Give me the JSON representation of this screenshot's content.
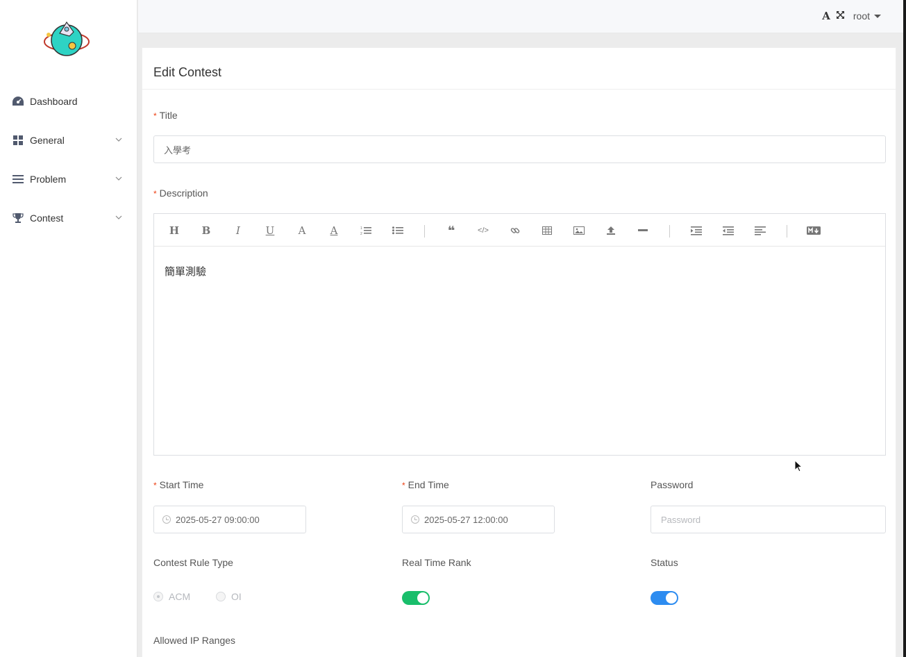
{
  "header": {
    "user": "root"
  },
  "sidebar": {
    "items": [
      {
        "label": "Dashboard"
      },
      {
        "label": "General"
      },
      {
        "label": "Problem"
      },
      {
        "label": "Contest"
      }
    ]
  },
  "card": {
    "title": "Edit Contest"
  },
  "form": {
    "title_label": "Title",
    "title_value": "入學考",
    "description_label": "Description",
    "description_value": "簡單測驗",
    "start_time_label": "Start Time",
    "start_time_value": "2025-05-27 09:00:00",
    "end_time_label": "End Time",
    "end_time_value": "2025-05-27 12:00:00",
    "password_label": "Password",
    "password_placeholder": "Password",
    "rule_type_label": "Contest Rule Type",
    "rule_options": [
      "ACM",
      "OI"
    ],
    "rule_selected": "ACM",
    "real_time_rank_label": "Real Time Rank",
    "status_label": "Status",
    "allowed_ip_label": "Allowed IP Ranges"
  },
  "toolbar_icons": [
    "heading-icon",
    "bold-icon",
    "italic-icon",
    "underline-icon",
    "font-color-icon",
    "background-color-icon",
    "ordered-list-icon",
    "unordered-list-icon",
    "quote-icon",
    "code-icon",
    "link-icon",
    "table-icon",
    "image-icon",
    "upload-icon",
    "horizontal-rule-icon",
    "indent-icon",
    "outdent-icon",
    "align-icon",
    "markdown-icon"
  ],
  "colors": {
    "switch_green": "#19be6b",
    "switch_blue": "#2d8cf0",
    "required": "#ed4014"
  }
}
